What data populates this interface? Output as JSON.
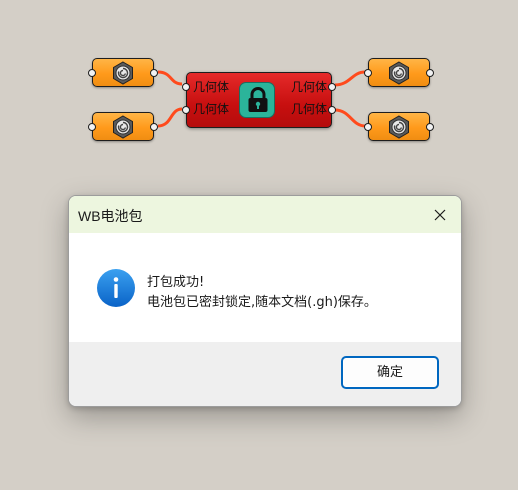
{
  "canvas": {
    "component": {
      "inputs": [
        "几何体",
        "几何体"
      ],
      "outputs": [
        "几何体",
        "几何体"
      ],
      "color": "#c70f0f",
      "icon": "lock-icon"
    },
    "params": {
      "count": 4,
      "color": "#ff9a1b",
      "icon": "geometry-param-icon"
    },
    "wire_color": "#ff4a1c"
  },
  "dialog": {
    "title": "WB电池包",
    "message_line1": "打包成功!",
    "message_line2": "电池包已密封锁定,随本文档(.gh)保存。",
    "ok_label": "确定",
    "icon": "info-icon",
    "titlebar_color": "#edf6df",
    "accent_color": "#0067c0"
  }
}
